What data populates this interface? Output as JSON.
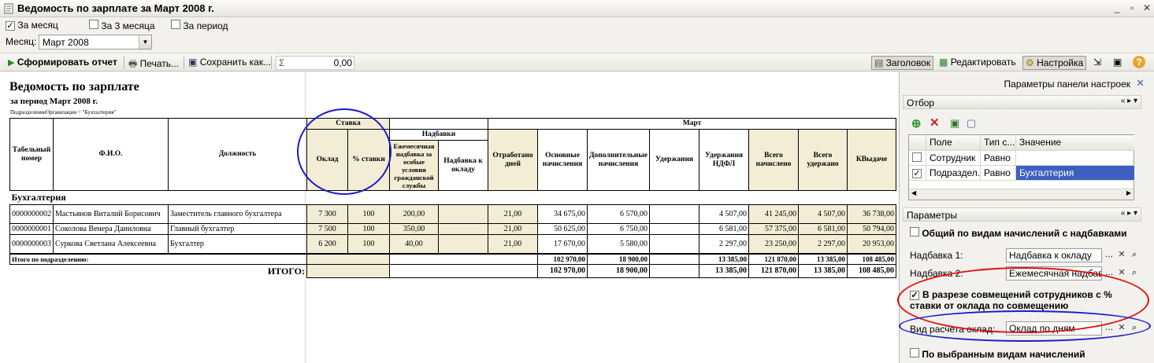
{
  "window": {
    "title": "Ведомость по зарплате  за Март 2008 г.",
    "controls": [
      "_",
      "▫",
      "✕"
    ]
  },
  "period_options": [
    {
      "label": "За месяц",
      "checked": true
    },
    {
      "label": "За 3 месяца",
      "checked": false
    },
    {
      "label": "За период",
      "checked": false
    }
  ],
  "month": {
    "label": "Месяц:",
    "value": "Март 2008"
  },
  "toolbar": {
    "generate": "Сформировать отчет",
    "print": "Печать...",
    "save": "Сохранить как...",
    "sigma": "Σ",
    "sum_value": "0,00",
    "header": "Заголовок",
    "edit": "Редактировать",
    "settings": "Настройка",
    "help": "?"
  },
  "report": {
    "title": "Ведомость по зарплате",
    "period": "за период Март 2008 г.",
    "filter": "ПодразделениеОрганизации = \"Бухгалтерия\"",
    "headers": {
      "tab": "Табельный номер",
      "fio": "Ф.И.О.",
      "position": "Должность",
      "stavka": "Ставка",
      "oklad": "Оклад",
      "percent": "% ставки",
      "nadbavki": "Надбавки",
      "monthly_bonus": "Ежемесячная надбавка за особые условия гражданской службы",
      "oklad_bonus": "Надбавка к окладу",
      "month": "Март",
      "days": "Отработано дней",
      "basic": "Основные начисления",
      "additional": "Дополнительные начисления",
      "deductions": "Удержания",
      "ndfl": "Удержания НДФЛ",
      "total_accrued": "Всего начислено",
      "total_withheld": "Всего удержано",
      "to_pay": "КВыдаче"
    },
    "group": "Бухгалтерия",
    "rows": [
      {
        "tab": "0000000002",
        "fio": "Мастьянов Виталий Борисович",
        "position": "Заместитель главного бухгалтера",
        "oklad": "7 300",
        "percent": "100",
        "monthly_bonus": "200,00",
        "oklad_bonus": "",
        "days": "21,00",
        "basic": "34 675,00",
        "additional": "6 570,00",
        "deductions": "",
        "ndfl": "4 507,00",
        "total_accrued": "41 245,00",
        "total_withheld": "4 507,00",
        "to_pay": "36 738,00"
      },
      {
        "tab": "0000000001",
        "fio": "Соколова Венера Даниловна",
        "position": "Главный бухгалтер",
        "oklad": "7 500",
        "percent": "100",
        "monthly_bonus": "350,00",
        "oklad_bonus": "",
        "days": "21,00",
        "basic": "50 625,00",
        "additional": "6 750,00",
        "deductions": "",
        "ndfl": "6 581,00",
        "total_accrued": "57 375,00",
        "total_withheld": "6 581,00",
        "to_pay": "50 794,00"
      },
      {
        "tab": "0000000003",
        "fio": "Суркова Светлана Алексеевна",
        "position": "Бухгалтер",
        "oklad": "6 200",
        "percent": "100",
        "monthly_bonus": "40,00",
        "oklad_bonus": "",
        "days": "21,00",
        "basic": "17 670,00",
        "additional": "5 580,00",
        "deductions": "",
        "ndfl": "2 297,00",
        "total_accrued": "23 250,00",
        "total_withheld": "2 297,00",
        "to_pay": "20 953,00"
      }
    ],
    "subtotal": {
      "label": "Итого по подразделению:",
      "basic": "102 970,00",
      "additional": "18 900,00",
      "ndfl": "13 385,00",
      "total_accrued": "121 870,00",
      "total_withheld": "13 385,00",
      "to_pay": "108 485,00"
    },
    "total": {
      "label": "ИТОГО:",
      "basic": "102 970,00",
      "additional": "18 900,00",
      "ndfl": "13 385,00",
      "total_accrued": "121 870,00",
      "total_withheld": "13 385,00",
      "to_pay": "108 485,00"
    }
  },
  "panel": {
    "title": "Параметры панели настроек",
    "close": "✕",
    "filter_section": "Отбор",
    "filter_columns": [
      "Поле",
      "Тип с...",
      "Значение"
    ],
    "filter_rows": [
      {
        "checked": false,
        "field": "Сотрудник",
        "type": "Равно",
        "value": ""
      },
      {
        "checked": true,
        "field": "Подраздел...",
        "type": "Равно",
        "value": "Бухгалтерия"
      }
    ],
    "params_section": "Параметры",
    "general_by_types": "Общий по видам начислений с надбавками",
    "bonus1_label": "Надбавка 1:",
    "bonus1_value": "Надбавка к окладу",
    "bonus2_label": "Надбавка 2:",
    "bonus2_value": "Ежемесячная надбавка",
    "combine_label": "В разрезе совмещений сотрудников с % ставки от оклада по совмещению",
    "calc_type_label": "Вид расчета оклад:",
    "calc_type_value": "Оклад по дням",
    "selected_types": "По выбранным видам начислений"
  },
  "colors": {
    "annotation_blue": "#1a1acc",
    "annotation_red": "#e01010",
    "header_fill": "#f4edd5",
    "selection": "#3c5fc0"
  }
}
